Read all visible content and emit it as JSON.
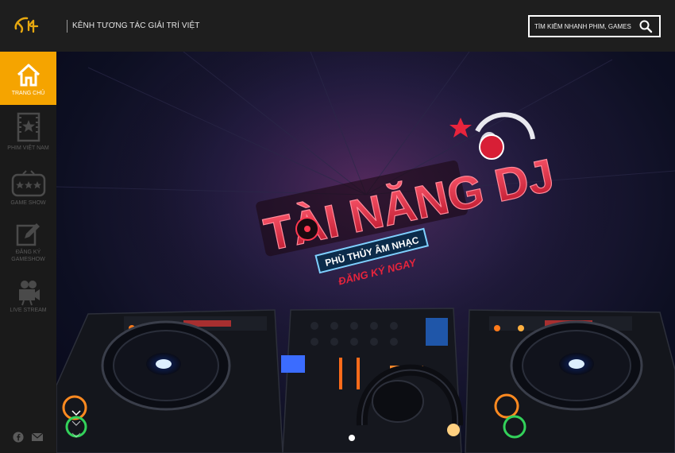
{
  "header": {
    "tagline": "KÊNH TƯƠNG TÁC GIẢI TRÍ VIỆT",
    "search": {
      "placeholder": "TÌM KIẾM NHANH PHIM, GAMESHOW...",
      "icon": "search-icon"
    }
  },
  "sidebar": {
    "items": [
      {
        "label": "TRANG CHỦ",
        "icon": "home-icon",
        "active": true
      },
      {
        "label": "PHIM VIỆT NAM",
        "icon": "film-star-icon",
        "active": false
      },
      {
        "label": "GAME SHOW",
        "icon": "tv-stars-icon",
        "active": false
      },
      {
        "label_lines": [
          "ĐĂNG KÝ",
          "GAMESHOW"
        ],
        "icon": "edit-icon",
        "active": false
      },
      {
        "label": "LIVE STREAM",
        "icon": "video-camera-icon",
        "active": false
      }
    ],
    "social": [
      "facebook-icon",
      "mail-icon"
    ]
  },
  "banner": {
    "logo_text": "TÀI NĂNG DJ",
    "ribbon": "PHÙ THỦY ÂM NHẠC",
    "cta": "ĐĂNG KÝ NGAY"
  },
  "colors": {
    "accent": "#f5a400",
    "header_bg": "#1e1e1e",
    "sidebar_bg": "#1a1a1a",
    "logo_red": "#e8243c"
  }
}
